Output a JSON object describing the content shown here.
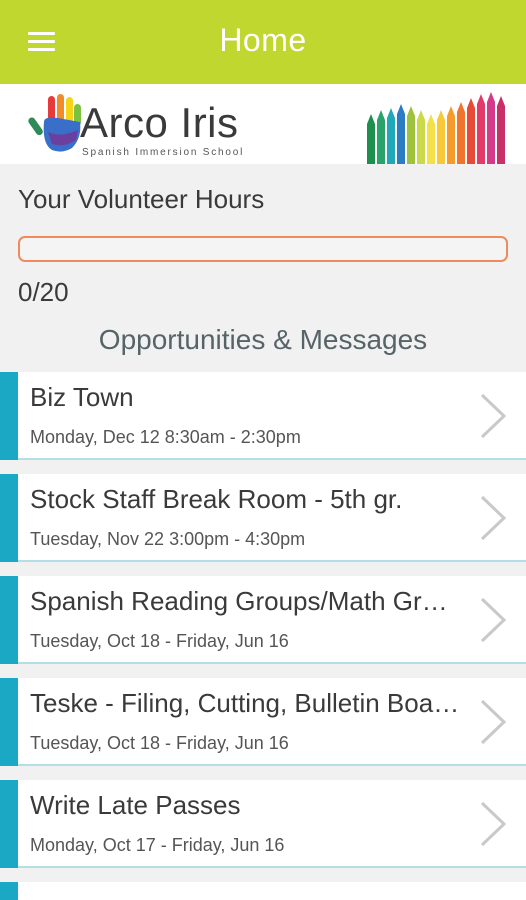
{
  "header": {
    "title": "Home",
    "menu_icon": "hamburger-menu-icon",
    "background_color": "#c0d72f"
  },
  "banner": {
    "logo_name": "Arco Iris",
    "logo_subtitle": "Spanish Immersion School"
  },
  "volunteer": {
    "title": "Your Volunteer Hours",
    "count_text": "0/20",
    "progress_fraction": 0,
    "progress_color": "#f08a5d"
  },
  "section": {
    "title": "Opportunities & Messages"
  },
  "opportunities": [
    {
      "title": "Biz Town",
      "date": "Monday, Dec 12 8:30am - 2:30pm"
    },
    {
      "title": "Stock Staff Break Room - 5th gr.",
      "date": "Tuesday, Nov 22 3:00pm - 4:30pm"
    },
    {
      "title": "Spanish Reading Groups/Math Groups",
      "date": "Tuesday, Oct 18 - Friday, Jun 16"
    },
    {
      "title": "Teske - Filing, Cutting, Bulletin Boards",
      "date": "Tuesday, Oct 18 - Friday, Jun 16"
    },
    {
      "title": "Write Late Passes",
      "date": "Monday, Oct 17 - Friday, Jun 16"
    }
  ],
  "colors": {
    "accent": "#1ba8c4",
    "card_border": "#b5dde6"
  }
}
